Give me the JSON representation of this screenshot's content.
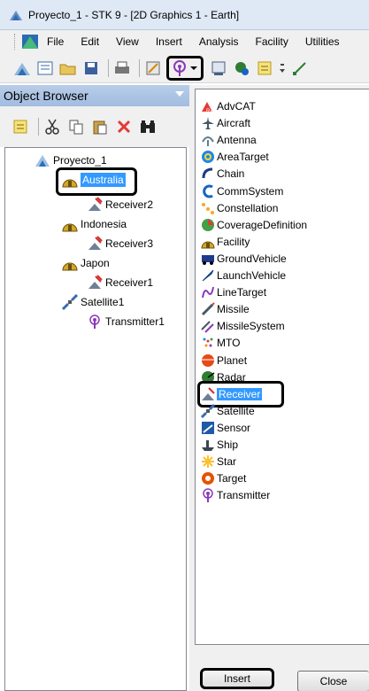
{
  "window": {
    "title": "Proyecto_1 - STK 9 - [2D Graphics 1 - Earth]"
  },
  "menu": [
    "File",
    "Edit",
    "View",
    "Insert",
    "Analysis",
    "Facility",
    "Utilities"
  ],
  "object_browser": {
    "title": "Object Browser",
    "tree": {
      "root": "Proyecto_1",
      "nodes": [
        {
          "label": "Australia",
          "selected": true,
          "children": [
            "Receiver2"
          ]
        },
        {
          "label": "Indonesia",
          "children": [
            "Receiver3"
          ]
        },
        {
          "label": "Japon",
          "children": [
            "Receiver1"
          ]
        },
        {
          "label": "Satellite1",
          "children": [
            "Transmitter1"
          ]
        }
      ]
    }
  },
  "insert_dialog": {
    "items": [
      "AdvCAT",
      "Aircraft",
      "Antenna",
      "AreaTarget",
      "Chain",
      "CommSystem",
      "Constellation",
      "CoverageDefinition",
      "Facility",
      "GroundVehicle",
      "LaunchVehicle",
      "LineTarget",
      "Missile",
      "MissileSystem",
      "MTO",
      "Planet",
      "Radar",
      "Receiver",
      "Satellite",
      "Sensor",
      "Ship",
      "Star",
      "Target",
      "Transmitter"
    ],
    "selected": "Receiver",
    "insert_label": "Insert",
    "close_label": "Close"
  },
  "colors": {
    "selection": "#3399ff",
    "highlight_outline": "#000000",
    "header": "#a9c2e4"
  }
}
